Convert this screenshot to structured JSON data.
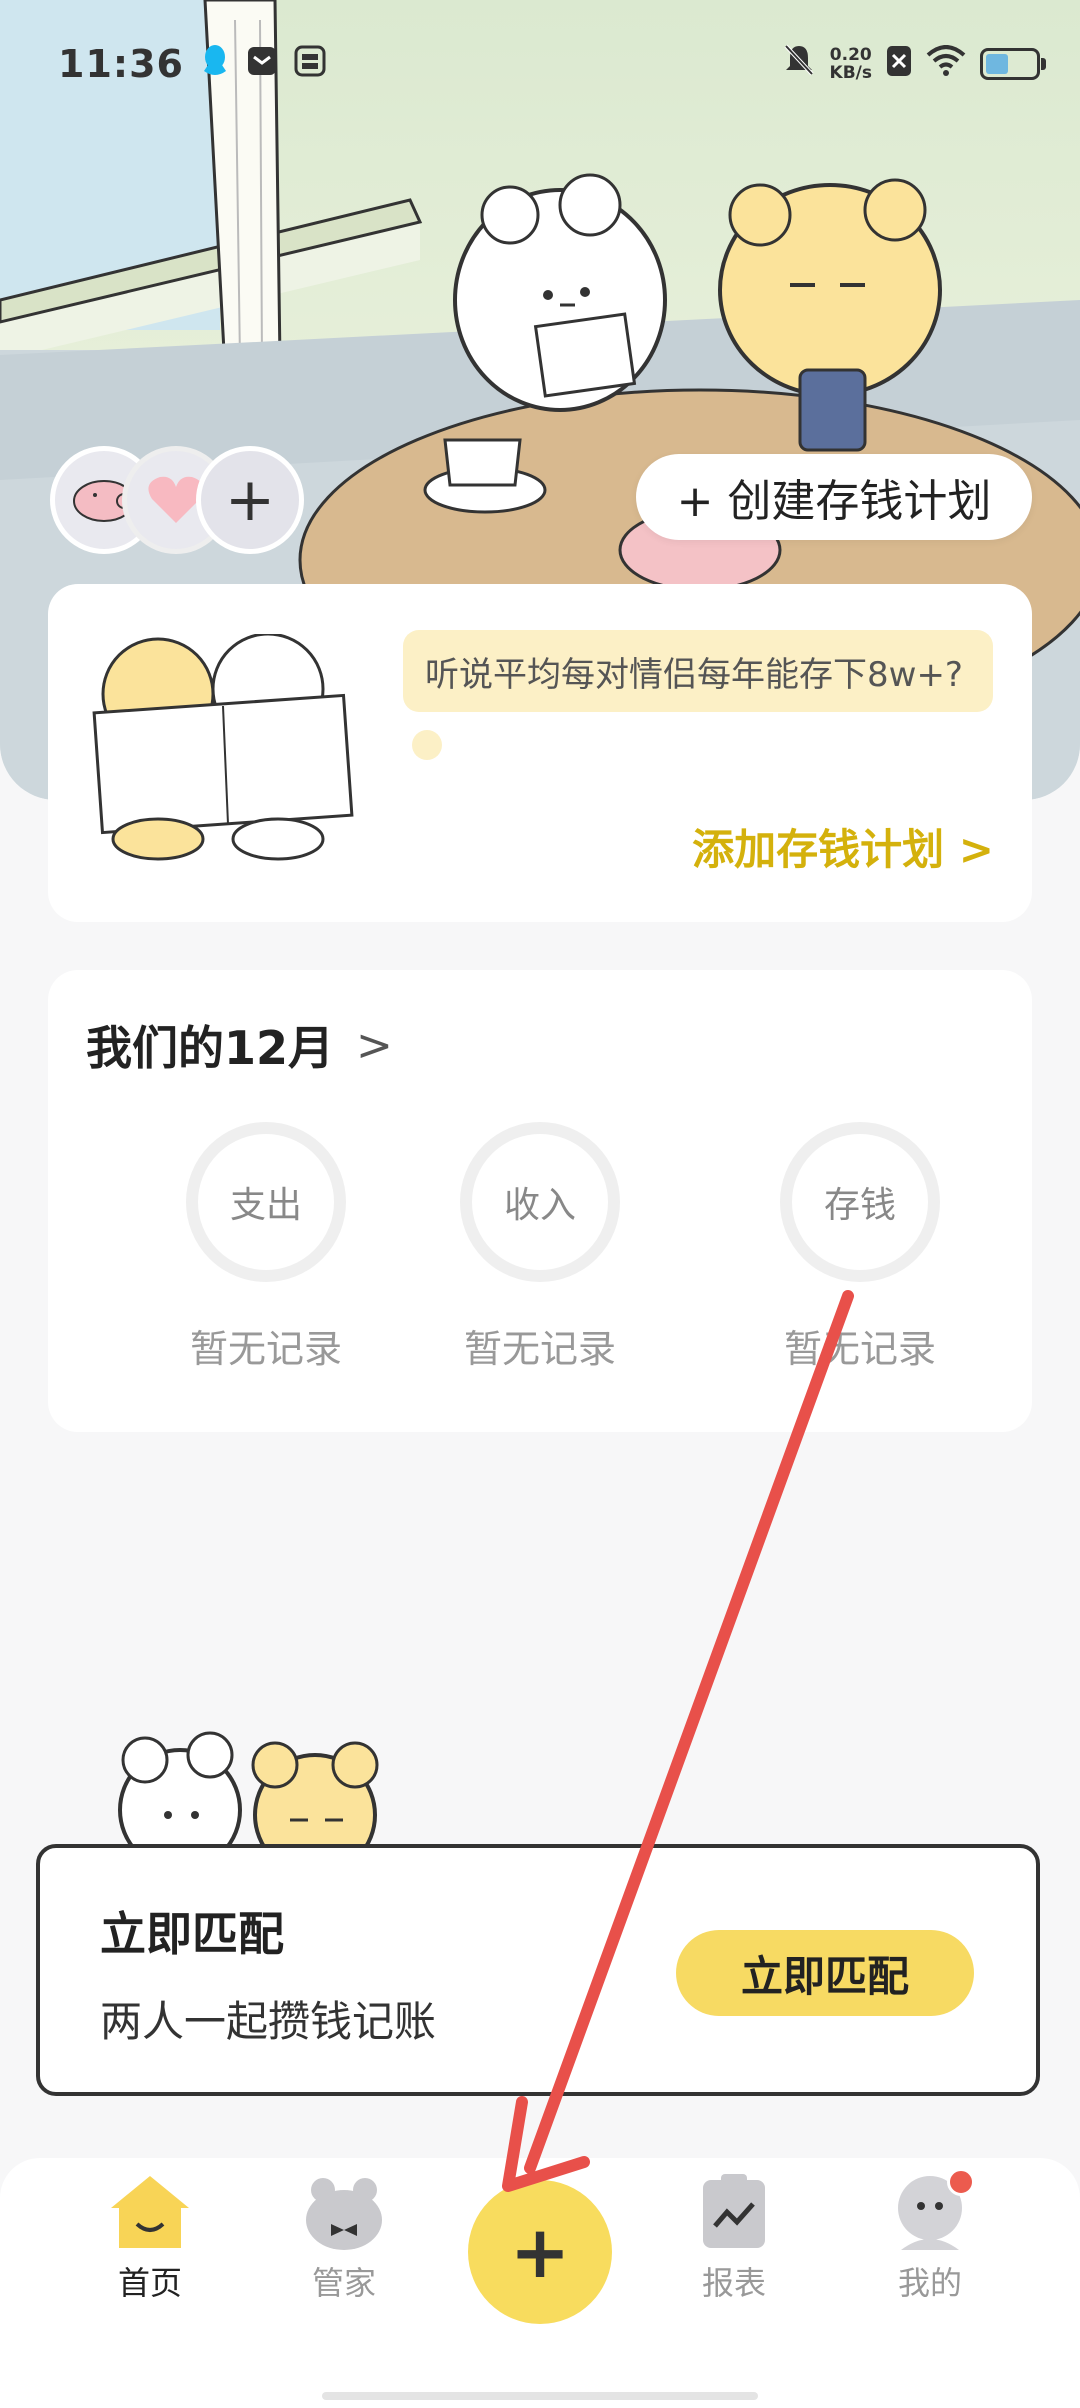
{
  "status_bar": {
    "time": "11:36",
    "net_speed_value": "0.20",
    "net_speed_unit": "KB/s"
  },
  "header": {
    "create_plan_button": "+ 创建存钱计划"
  },
  "tip_card": {
    "bubble_text": "听说平均每对情侣每年能存下8w+?",
    "add_plan_link": "添加存钱计划 >"
  },
  "month_card": {
    "title": "我们的12月",
    "stats": [
      {
        "label": "支出",
        "value": "暂无记录"
      },
      {
        "label": "收入",
        "value": "暂无记录"
      },
      {
        "label": "存钱",
        "value": "暂无记录"
      }
    ]
  },
  "match_card": {
    "title": "立即匹配",
    "subtitle": "两人一起攒钱记账",
    "button": "立即匹配"
  },
  "tabbar": {
    "tabs": [
      {
        "label": "首页",
        "icon": "home-icon"
      },
      {
        "label": "管家",
        "icon": "butler-icon"
      },
      {
        "label": "报表",
        "icon": "report-icon"
      },
      {
        "label": "我的",
        "icon": "profile-icon"
      }
    ],
    "fab_icon": "plus-icon"
  },
  "colors": {
    "accent": "#f8dc5e",
    "link": "#d4b10c",
    "badge": "#ec5b4e",
    "annotation_arrow": "#e8504a"
  }
}
